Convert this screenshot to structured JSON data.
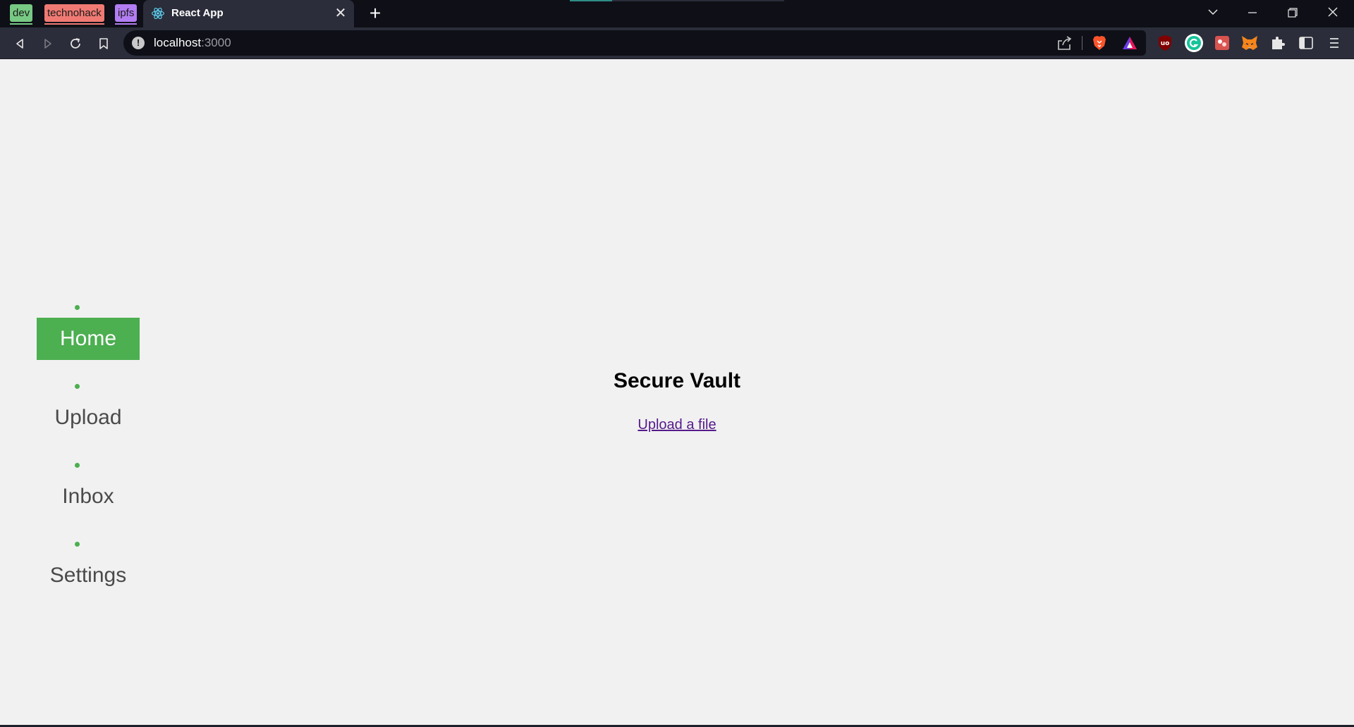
{
  "browser": {
    "tab_groups": [
      {
        "label": "dev",
        "color": "#77c983"
      },
      {
        "label": "technohack",
        "color": "#f07a73"
      },
      {
        "label": "ipfs",
        "color": "#b27df2"
      }
    ],
    "active_tab": {
      "title": "React App",
      "favicon": "react-atom-icon"
    },
    "url": {
      "host": "localhost",
      "port": ":3000"
    },
    "extensions": [
      "brave-shields-icon",
      "brave-rewards-icon",
      "ublock-origin-icon",
      "grammarly-icon",
      "red-extension-icon",
      "metamask-fox-icon",
      "puzzle-extensions-icon"
    ]
  },
  "sidebar": {
    "items": [
      {
        "label": "Home",
        "active": true
      },
      {
        "label": "Upload",
        "active": false
      },
      {
        "label": "Inbox",
        "active": false
      },
      {
        "label": "Settings",
        "active": false
      }
    ],
    "accent_color": "#4caf50"
  },
  "main": {
    "title": "Secure Vault",
    "upload_link": "Upload a file"
  }
}
